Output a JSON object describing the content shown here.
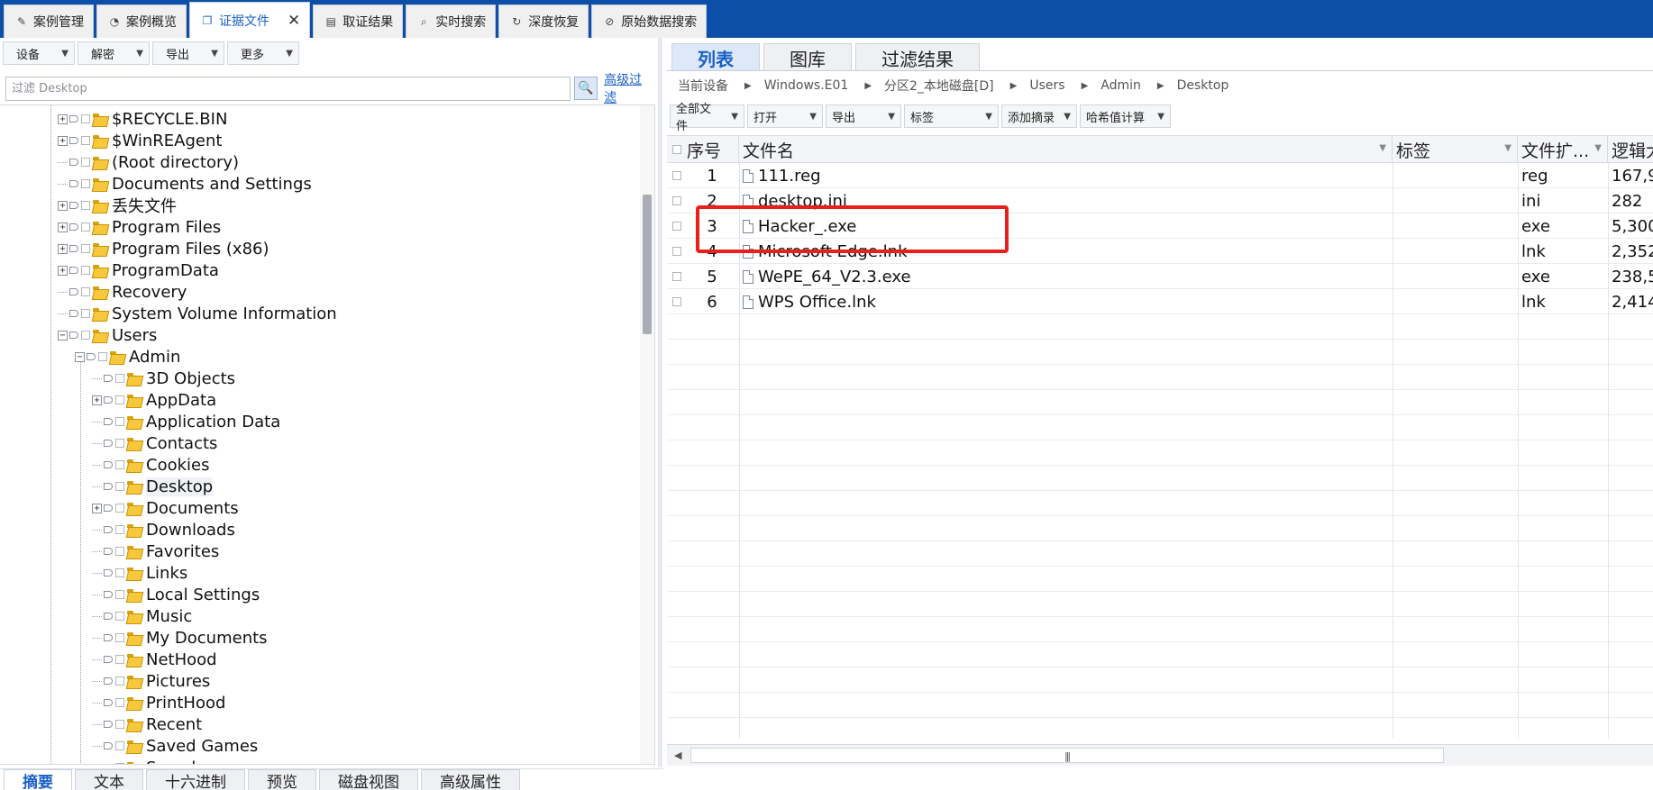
{
  "top_tabs": [
    {
      "label": "案例管理",
      "icon": "edit-icon"
    },
    {
      "label": "案例概览",
      "icon": "pie-chart-icon"
    },
    {
      "label": "证据文件",
      "icon": "file-copy-icon",
      "active": true,
      "closable": true
    },
    {
      "label": "取证结果",
      "icon": "result-icon"
    },
    {
      "label": "实时搜索",
      "icon": "search-icon"
    },
    {
      "label": "深度恢复",
      "icon": "recover-icon"
    },
    {
      "label": "原始数据搜索",
      "icon": "raw-data-search-icon"
    }
  ],
  "left_toolbar": {
    "device": "设备",
    "decrypt": "解密",
    "export": "导出",
    "more": "更多"
  },
  "filter": {
    "placeholder": "过滤 Desktop",
    "advanced_link": "高级过滤"
  },
  "tree": [
    {
      "label": "$RECYCLE.BIN",
      "expandable": true
    },
    {
      "label": "$WinREAgent",
      "expandable": true
    },
    {
      "label": "(Root directory)",
      "expandable": false
    },
    {
      "label": "Documents and Settings",
      "expandable": false
    },
    {
      "label": "丢失文件",
      "expandable": true
    },
    {
      "label": "Program Files",
      "expandable": true
    },
    {
      "label": "Program Files (x86)",
      "expandable": true
    },
    {
      "label": "ProgramData",
      "expandable": true
    },
    {
      "label": "Recovery",
      "expandable": false
    },
    {
      "label": "System Volume Information",
      "expandable": false
    },
    {
      "label": "Users",
      "expandable": true,
      "expanded": true
    },
    {
      "label": "Admin",
      "expandable": true,
      "expanded": true
    },
    {
      "label": "3D Objects",
      "expandable": false
    },
    {
      "label": "AppData",
      "expandable": true
    },
    {
      "label": "Application Data",
      "expandable": false
    },
    {
      "label": "Contacts",
      "expandable": false
    },
    {
      "label": "Cookies",
      "expandable": false
    },
    {
      "label": "Desktop",
      "expandable": false,
      "selected": true
    },
    {
      "label": "Documents",
      "expandable": true
    },
    {
      "label": "Downloads",
      "expandable": false
    },
    {
      "label": "Favorites",
      "expandable": false
    },
    {
      "label": "Links",
      "expandable": false
    },
    {
      "label": "Local Settings",
      "expandable": false
    },
    {
      "label": "Music",
      "expandable": false
    },
    {
      "label": "My Documents",
      "expandable": false
    },
    {
      "label": "NetHood",
      "expandable": false
    },
    {
      "label": "Pictures",
      "expandable": false
    },
    {
      "label": "PrintHood",
      "expandable": false
    },
    {
      "label": "Recent",
      "expandable": false
    },
    {
      "label": "Saved Games",
      "expandable": false
    },
    {
      "label": "Searches",
      "expandable": false
    }
  ],
  "bottom_tabs": [
    {
      "label": "摘要",
      "active": true
    },
    {
      "label": "文本"
    },
    {
      "label": "十六进制"
    },
    {
      "label": "预览"
    },
    {
      "label": "磁盘视图"
    },
    {
      "label": "高级属性"
    }
  ],
  "view_tabs": [
    {
      "label": "列表",
      "active": true
    },
    {
      "label": "图库"
    },
    {
      "label": "过滤结果"
    }
  ],
  "breadcrumb": [
    "当前设备",
    "Windows.E01",
    "分区2_本地磁盘[D]",
    "Users",
    "Admin",
    "Desktop"
  ],
  "right_toolbar": {
    "all_files": "全部文件",
    "open": "打开",
    "export": "导出",
    "tags": "标签",
    "add_summary": "添加摘录",
    "hash_calc": "哈希值计算"
  },
  "table": {
    "columns": [
      "序号",
      "文件名",
      "标签",
      "文件扩...",
      "逻辑大"
    ],
    "rows": [
      {
        "index": "1",
        "name": "111.reg",
        "tag": "",
        "ext": "reg",
        "size": "167,9"
      },
      {
        "index": "2",
        "name": "desktop.ini",
        "tag": "",
        "ext": "ini",
        "size": "282"
      },
      {
        "index": "3",
        "name": "Hacker_.exe",
        "tag": "",
        "ext": "exe",
        "size": "5,300"
      },
      {
        "index": "4",
        "name": "Microsoft Edge.lnk",
        "tag": "",
        "ext": "lnk",
        "size": "2,352"
      },
      {
        "index": "5",
        "name": "WePE_64_V2.3.exe",
        "tag": "",
        "ext": "exe",
        "size": "238,5"
      },
      {
        "index": "6",
        "name": "WPS Office.lnk",
        "tag": "",
        "ext": "lnk",
        "size": "2,414"
      }
    ],
    "highlighted_row": "3",
    "highlight_color": "#e8201c"
  },
  "colors": {
    "accent": "#1a5fc8",
    "title_bar": "#0d4fa8",
    "folder": "#f7c83b"
  }
}
